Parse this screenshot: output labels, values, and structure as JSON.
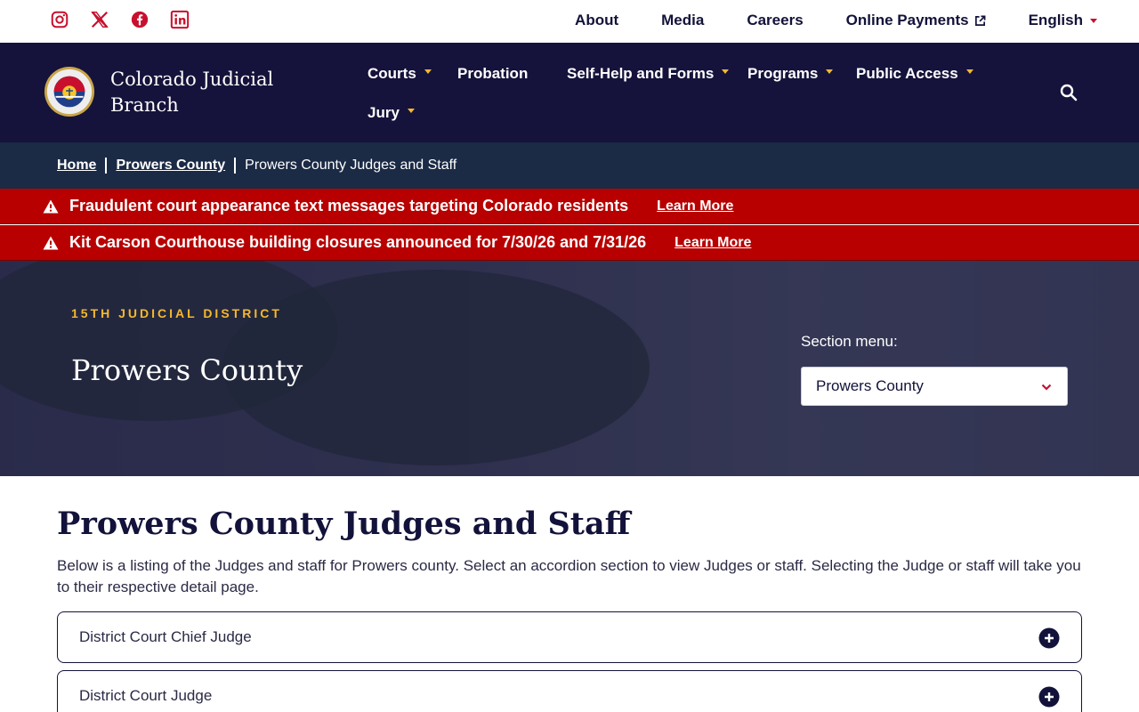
{
  "social": {
    "icons": [
      "instagram-icon",
      "x-icon",
      "facebook-icon",
      "linkedin-icon"
    ],
    "color": "#c8102e"
  },
  "utility_nav": {
    "about": "About",
    "media": "Media",
    "careers": "Careers",
    "online_payments": "Online Payments",
    "language": "English"
  },
  "header": {
    "brand_line1": "Colorado Judicial",
    "brand_line2": "Branch",
    "logo_text": "COLORADO COURTS",
    "nav": {
      "courts": "Courts",
      "probation": "Probation",
      "self_help": "Self-Help and Forms",
      "programs": "Programs",
      "public_access": "Public Access",
      "jury": "Jury"
    }
  },
  "breadcrumb": {
    "home": "Home",
    "county": "Prowers County",
    "current": "Prowers County Judges and Staff"
  },
  "alerts": [
    {
      "message": "Fraudulent court appearance text messages targeting Colorado residents",
      "link": "Learn More"
    },
    {
      "message": "Kit Carson Courthouse building closures announced for 7/30/26 and 7/31/26",
      "link": "Learn More"
    }
  ],
  "hero": {
    "eyebrow": "15TH JUDICIAL DISTRICT",
    "title": "Prowers County",
    "section_menu_label": "Section menu:",
    "section_menu_value": "Prowers County"
  },
  "content": {
    "title": "Prowers County Judges and Staff",
    "intro": "Below is a listing of the Judges and staff for Prowers county. Select an accordion section to view Judges or staff. Selecting the Judge or staff will take you to their respective detail page.",
    "accordions": [
      "District Court Chief Judge",
      "District Court Judge"
    ]
  },
  "colors": {
    "navy": "#15133b",
    "breadcrumb_bg": "#1b2a45",
    "alert_red": "#b80000",
    "accent_gold": "#f5b82e"
  }
}
